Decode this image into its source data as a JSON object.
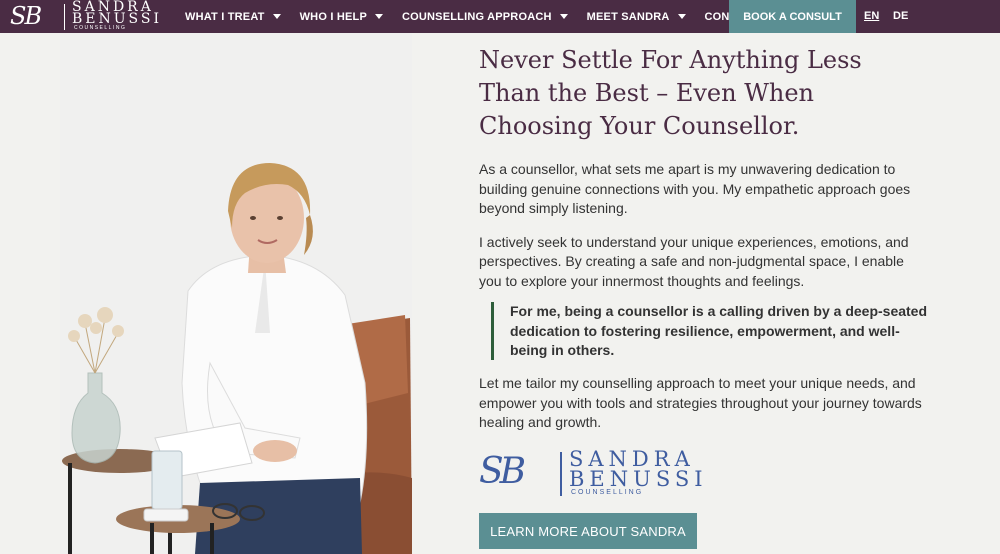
{
  "brand": {
    "monogram": "SB",
    "line1": "SANDRA",
    "line2": "BENUSSI",
    "line3": "COUNSELLING"
  },
  "nav": {
    "items": [
      {
        "label": "WHAT I TREAT",
        "has_dropdown": true
      },
      {
        "label": "WHO I HELP",
        "has_dropdown": true
      },
      {
        "label": "COUNSELLING APPROACH",
        "has_dropdown": true
      },
      {
        "label": "MEET SANDRA",
        "has_dropdown": true
      },
      {
        "label": "CONTACT",
        "has_dropdown": false
      }
    ],
    "cta_label": "BOOK A CONSULT",
    "languages": [
      "EN",
      "DE"
    ],
    "active_language": "EN"
  },
  "main": {
    "title": "Never Settle For Anything Less Than the Best – Even When Choosing Your Counsellor.",
    "paragraphs": [
      "As a counsellor, what sets me apart is my unwavering dedication to building genuine connections with you. My empathetic approach goes beyond simply listening.",
      "I actively seek to understand your unique experiences, emotions, and perspectives. By creating a safe and non-judgmental space, I enable you to explore your innermost thoughts and feelings."
    ],
    "quote": "For me, being a counsellor is a calling driven by a deep-seated dedication to fostering resilience, empowerment, and well-being in others.",
    "closing": "Let me tailor my counselling approach to meet your unique needs, and empower you with tools and strategies throughout your journey towards healing and growth.",
    "button_label": "LEARN MORE ABOUT SANDRA"
  },
  "colors": {
    "nav_bg": "#4a2c44",
    "accent": "#5b8f93",
    "title": "#4a2c44",
    "signature": "#3f5da0",
    "quote_border": "#2e5e3a"
  }
}
